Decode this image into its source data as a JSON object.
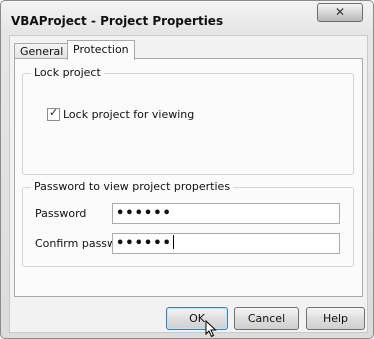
{
  "window": {
    "title": "VBAProject - Project Properties"
  },
  "tabs": [
    {
      "label": "General"
    },
    {
      "label": "Protection"
    }
  ],
  "lock_group": {
    "legend": "Lock project",
    "checkbox_label": "Lock project for viewing",
    "checked": true
  },
  "password_group": {
    "legend": "Password to view project properties",
    "password_label": "Password",
    "password_value": "••••••",
    "confirm_label": "Confirm password",
    "confirm_value": "••••••"
  },
  "buttons": {
    "ok": "OK",
    "cancel": "Cancel",
    "help": "Help"
  },
  "icons": {
    "close": "close-icon",
    "cursor": "mouse-pointer-icon"
  }
}
